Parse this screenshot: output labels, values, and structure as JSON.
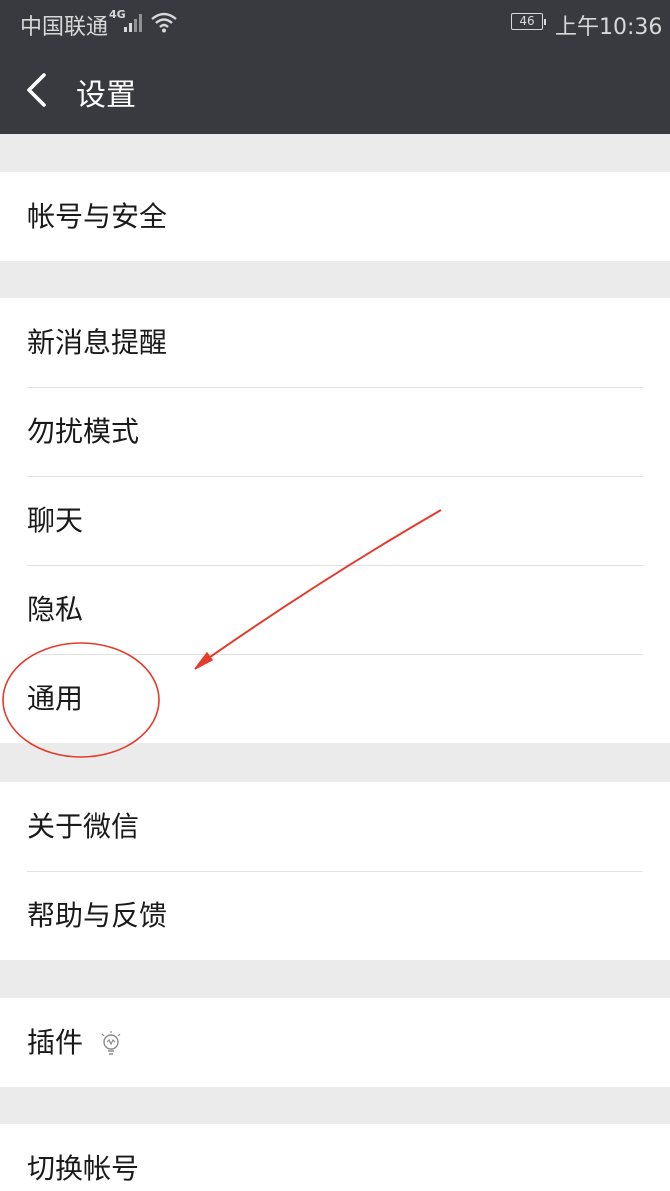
{
  "status_bar": {
    "carrier": "中国联通",
    "network": "4G",
    "battery": "46",
    "time": "上午10:36"
  },
  "header": {
    "title": "设置",
    "back_icon": "chevron-left-icon"
  },
  "groups": [
    {
      "items": [
        {
          "label": "帐号与安全"
        }
      ]
    },
    {
      "items": [
        {
          "label": "新消息提醒"
        },
        {
          "label": "勿扰模式"
        },
        {
          "label": "聊天"
        },
        {
          "label": "隐私"
        },
        {
          "label": "通用"
        }
      ]
    },
    {
      "items": [
        {
          "label": "关于微信"
        },
        {
          "label": "帮助与反馈"
        }
      ]
    },
    {
      "items": [
        {
          "label": "插件",
          "icon": "lightbulb-icon"
        }
      ]
    },
    {
      "items": [
        {
          "label": "切换帐号"
        }
      ]
    }
  ],
  "annotation": {
    "color": "#e53b2c",
    "target": "通用"
  },
  "colors": {
    "header_bg": "#393a3f",
    "page_bg": "#ebebeb"
  }
}
